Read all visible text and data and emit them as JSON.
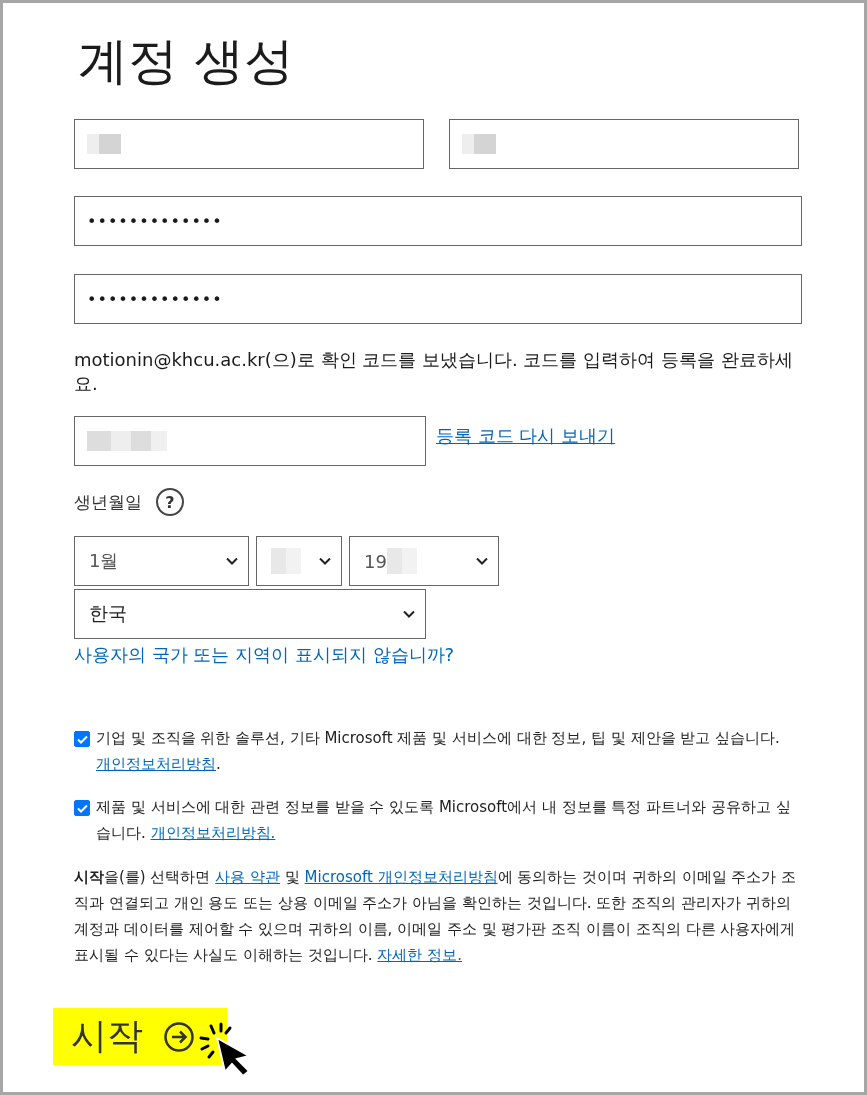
{
  "title": "계정 생성",
  "name_fields": [
    {
      "masked": true
    },
    {
      "masked": true
    }
  ],
  "password_fields": [
    {
      "value": "•••••••••••••"
    },
    {
      "value": "•••••••••••••"
    }
  ],
  "verification_message": "motionin@khcu.ac.kr(으)로 확인 코드를 보냈습니다. 코드를 입력하여 등록을 완료하세요.",
  "code_field": {
    "masked": true
  },
  "resend_link": "등록 코드 다시 보내기",
  "birthdate": {
    "label": "생년월일",
    "help_icon": "?",
    "month": {
      "value": "1월"
    },
    "day": {
      "masked": true
    },
    "year": {
      "value": "19",
      "masked": true
    }
  },
  "country": "한국",
  "country_link": "사용자의 국가 또는 지역이 표시되지 않습니까?",
  "consents": [
    {
      "checked": true,
      "text": "기업 및 조직을 위한 솔루션, 기타 Microsoft 제품 및 서비스에 대한 정보, 팁 및 제안을 받고 싶습니다. ",
      "link": "개인정보처리방침",
      "after": "."
    },
    {
      "checked": true,
      "text": "제품 및 서비스에 대한 관련 정보를 받을 수 있도록 Microsoft에서 내 정보를 특정 파트너와 공유하고 싶습니다. ",
      "link": "개인정보처리방침."
    }
  ],
  "terms": [
    {
      "kind": "text",
      "text": "**시작**을(를) 선택하면 "
    },
    {
      "kind": "link",
      "text": "사용 약관"
    },
    {
      "kind": "text",
      "text": " 및 "
    },
    {
      "kind": "link",
      "text": "Microsoft 개인정보처리방침"
    },
    {
      "kind": "text",
      "text": "에 동의하는 것이며 귀하의 이메일 주소가 조직과 연결되고 개인 용도 또는 상용 이메일 주소가 아님을 확인하는 것입니다. 또한 조직의 관리자가 귀하의 계정과 데이터를 제어할 수 있으며 귀하의 이름, 이메일 주소 및 평가판 조직 이름이 조직의 다른 사용자에게 표시될 수 있다는 사실도 이해하는 것입니다. "
    },
    {
      "kind": "link",
      "text": "자세한 정보."
    }
  ],
  "start_button": {
    "label": "시작"
  }
}
